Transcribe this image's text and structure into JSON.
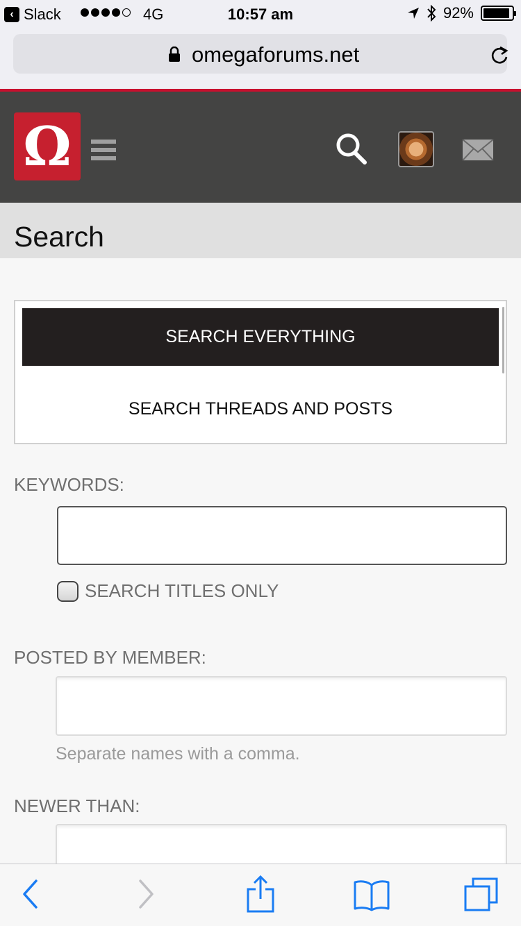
{
  "status_bar": {
    "back_app": "Slack",
    "network": "4G",
    "time": "10:57 am",
    "battery": "92%",
    "battery_level": 0.92,
    "signal_bars_filled": 4,
    "signal_bars_total": 5
  },
  "browser": {
    "url": "omegaforums.net"
  },
  "site_header": {
    "logo_glyph": "Ω",
    "icons": [
      "menu-icon",
      "search-icon",
      "avatar",
      "mail-icon"
    ]
  },
  "page": {
    "title": "Search"
  },
  "search_tabs": {
    "active": "SEARCH EVERYTHING",
    "inactive": "SEARCH THREADS AND POSTS"
  },
  "form": {
    "keywords_label": "KEYWORDS:",
    "keywords_value": "",
    "search_titles_only_label": "SEARCH TITLES ONLY",
    "search_titles_only_checked": false,
    "posted_by_label": "POSTED BY MEMBER:",
    "posted_by_value": "",
    "posted_by_hint": "Separate names with a comma.",
    "newer_than_label": "NEWER THAN:",
    "newer_than_value": ""
  },
  "toolbar": {
    "icons": [
      "back-icon",
      "forward-icon",
      "share-icon",
      "bookmarks-icon",
      "tabs-icon"
    ]
  },
  "colors": {
    "brand_red": "#c6202f",
    "header_bg": "#444443",
    "active_tab_bg": "#231f1f",
    "ios_blue": "#1a7cf3"
  }
}
